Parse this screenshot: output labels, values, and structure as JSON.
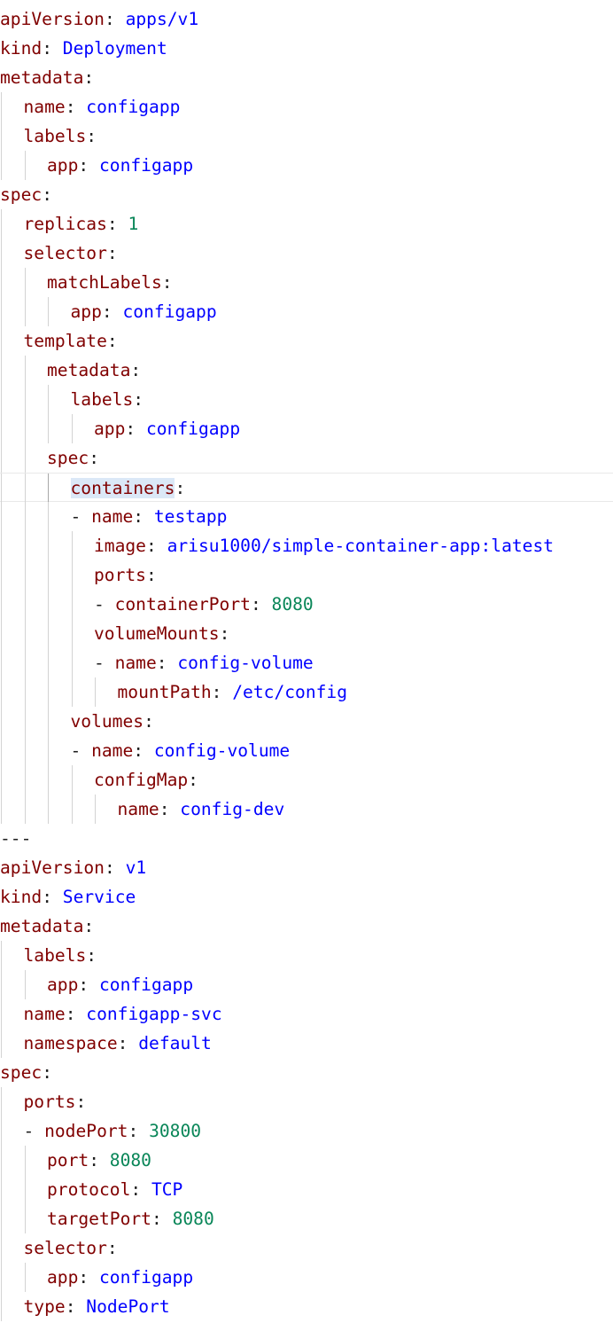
{
  "editor": {
    "language": "yaml",
    "highlight_word": "containers",
    "lines": [
      {
        "indent": 0,
        "dash": false,
        "key": "apiVersion",
        "value": "apps/v1",
        "vtype": "str"
      },
      {
        "indent": 0,
        "dash": false,
        "key": "kind",
        "value": "Deployment",
        "vtype": "str"
      },
      {
        "indent": 0,
        "dash": false,
        "key": "metadata",
        "value": "",
        "vtype": ""
      },
      {
        "indent": 1,
        "dash": false,
        "key": "name",
        "value": "configapp",
        "vtype": "str"
      },
      {
        "indent": 1,
        "dash": false,
        "key": "labels",
        "value": "",
        "vtype": ""
      },
      {
        "indent": 2,
        "dash": false,
        "key": "app",
        "value": "configapp",
        "vtype": "str"
      },
      {
        "indent": 0,
        "dash": false,
        "key": "spec",
        "value": "",
        "vtype": ""
      },
      {
        "indent": 1,
        "dash": false,
        "key": "replicas",
        "value": "1",
        "vtype": "num"
      },
      {
        "indent": 1,
        "dash": false,
        "key": "selector",
        "value": "",
        "vtype": ""
      },
      {
        "indent": 2,
        "dash": false,
        "key": "matchLabels",
        "value": "",
        "vtype": ""
      },
      {
        "indent": 3,
        "dash": false,
        "key": "app",
        "value": "configapp",
        "vtype": "str"
      },
      {
        "indent": 1,
        "dash": false,
        "key": "template",
        "value": "",
        "vtype": ""
      },
      {
        "indent": 2,
        "dash": false,
        "key": "metadata",
        "value": "",
        "vtype": ""
      },
      {
        "indent": 3,
        "dash": false,
        "key": "labels",
        "value": "",
        "vtype": ""
      },
      {
        "indent": 4,
        "dash": false,
        "key": "app",
        "value": "configapp",
        "vtype": "str"
      },
      {
        "indent": 2,
        "dash": false,
        "key": "spec",
        "value": "",
        "vtype": ""
      },
      {
        "indent": 3,
        "dash": false,
        "key": "containers",
        "value": "",
        "vtype": "",
        "current": true
      },
      {
        "indent": 3,
        "dash": true,
        "key": "name",
        "value": "testapp",
        "vtype": "str"
      },
      {
        "indent": 4,
        "dash": false,
        "key": "image",
        "value": "arisu1000/simple-container-app:latest",
        "vtype": "str"
      },
      {
        "indent": 4,
        "dash": false,
        "key": "ports",
        "value": "",
        "vtype": ""
      },
      {
        "indent": 4,
        "dash": true,
        "key": "containerPort",
        "value": "8080",
        "vtype": "num"
      },
      {
        "indent": 4,
        "dash": false,
        "key": "volumeMounts",
        "value": "",
        "vtype": ""
      },
      {
        "indent": 4,
        "dash": true,
        "key": "name",
        "value": "config-volume",
        "vtype": "str"
      },
      {
        "indent": 5,
        "dash": false,
        "key": "mountPath",
        "value": "/etc/config",
        "vtype": "str"
      },
      {
        "indent": 3,
        "dash": false,
        "key": "volumes",
        "value": "",
        "vtype": ""
      },
      {
        "indent": 3,
        "dash": true,
        "key": "name",
        "value": "config-volume",
        "vtype": "str"
      },
      {
        "indent": 4,
        "dash": false,
        "key": "configMap",
        "value": "",
        "vtype": ""
      },
      {
        "indent": 5,
        "dash": false,
        "key": "name",
        "value": "config-dev",
        "vtype": "str"
      },
      {
        "indent": 0,
        "dash": false,
        "raw": "---"
      },
      {
        "indent": 0,
        "dash": false,
        "key": "apiVersion",
        "value": "v1",
        "vtype": "str"
      },
      {
        "indent": 0,
        "dash": false,
        "key": "kind",
        "value": "Service",
        "vtype": "str"
      },
      {
        "indent": 0,
        "dash": false,
        "key": "metadata",
        "value": "",
        "vtype": ""
      },
      {
        "indent": 1,
        "dash": false,
        "key": "labels",
        "value": "",
        "vtype": ""
      },
      {
        "indent": 2,
        "dash": false,
        "key": "app",
        "value": "configapp",
        "vtype": "str"
      },
      {
        "indent": 1,
        "dash": false,
        "key": "name",
        "value": "configapp-svc",
        "vtype": "str"
      },
      {
        "indent": 1,
        "dash": false,
        "key": "namespace",
        "value": "default",
        "vtype": "str"
      },
      {
        "indent": 0,
        "dash": false,
        "key": "spec",
        "value": "",
        "vtype": ""
      },
      {
        "indent": 1,
        "dash": false,
        "key": "ports",
        "value": "",
        "vtype": ""
      },
      {
        "indent": 1,
        "dash": true,
        "key": "nodePort",
        "value": "30800",
        "vtype": "num"
      },
      {
        "indent": 2,
        "dash": false,
        "key": "port",
        "value": "8080",
        "vtype": "num"
      },
      {
        "indent": 2,
        "dash": false,
        "key": "protocol",
        "value": "TCP",
        "vtype": "str"
      },
      {
        "indent": 2,
        "dash": false,
        "key": "targetPort",
        "value": "8080",
        "vtype": "num"
      },
      {
        "indent": 1,
        "dash": false,
        "key": "selector",
        "value": "",
        "vtype": ""
      },
      {
        "indent": 2,
        "dash": false,
        "key": "app",
        "value": "configapp",
        "vtype": "str"
      },
      {
        "indent": 1,
        "dash": false,
        "key": "type",
        "value": "NodePort",
        "vtype": "str"
      }
    ]
  }
}
